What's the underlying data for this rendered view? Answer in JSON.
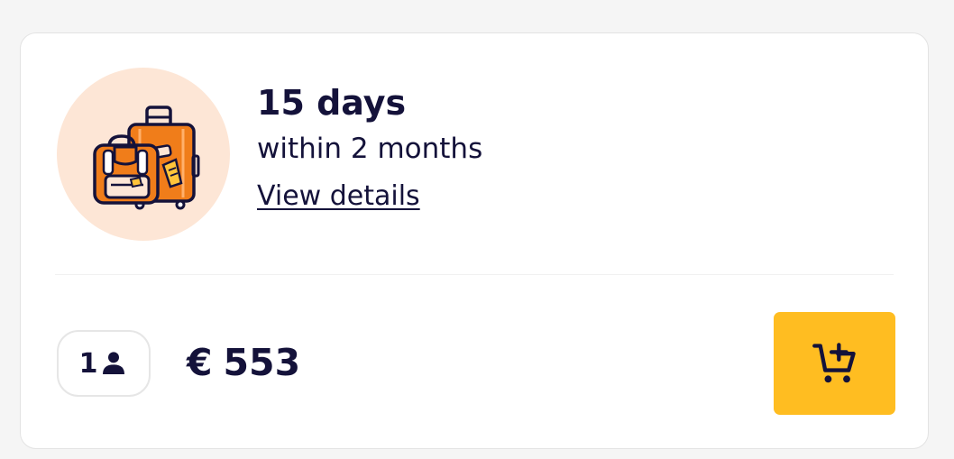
{
  "card": {
    "duration_title": "15 days",
    "validity_text": "within 2 months",
    "details_link": "View details"
  },
  "travellers": {
    "count": "1",
    "icon": "person-icon"
  },
  "price": {
    "currency": "€",
    "amount": "553"
  },
  "cart_button": {
    "icon": "add-to-cart-icon"
  },
  "colors": {
    "accent": "#ffbd21",
    "text": "#14123a",
    "illustration_bg": "#fde6d6",
    "luggage_orange": "#f07d1a"
  }
}
